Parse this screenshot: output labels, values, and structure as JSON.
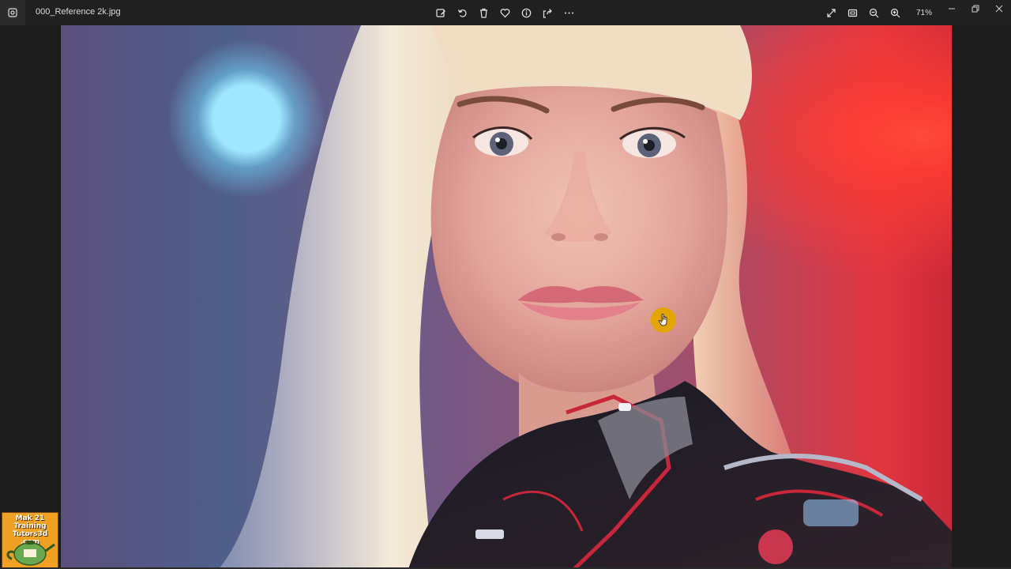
{
  "app": {
    "filename": "000_Reference 2k.jpg"
  },
  "toolbar": {
    "items": [
      {
        "icon": "edit-image-icon",
        "label": "Edit image"
      },
      {
        "icon": "rotate-icon",
        "label": "Rotate"
      },
      {
        "icon": "delete-icon",
        "label": "Delete"
      },
      {
        "icon": "favorite-heart-icon",
        "label": "Favorite"
      },
      {
        "icon": "file-info-icon",
        "label": "File information"
      },
      {
        "icon": "share-icon",
        "label": "Share"
      },
      {
        "icon": "more-options-icon",
        "label": "See more"
      }
    ]
  },
  "view": {
    "zoom_level": "71%",
    "tools": [
      "full-screen-icon",
      "fit-to-window-icon",
      "zoom-out-icon",
      "zoom-in-icon"
    ]
  },
  "window_controls": [
    "minimize",
    "restore",
    "close"
  ],
  "image": {
    "subject": "portrait-photo"
  },
  "watermark": {
    "line1": "Mak 21 Training",
    "line2": "Tutors3d .com"
  },
  "colors": {
    "titlebar": "#202020",
    "background": "#1c1c1c",
    "cursor_highlight": "#e3a400",
    "watermark_bg": "#f0a022"
  }
}
